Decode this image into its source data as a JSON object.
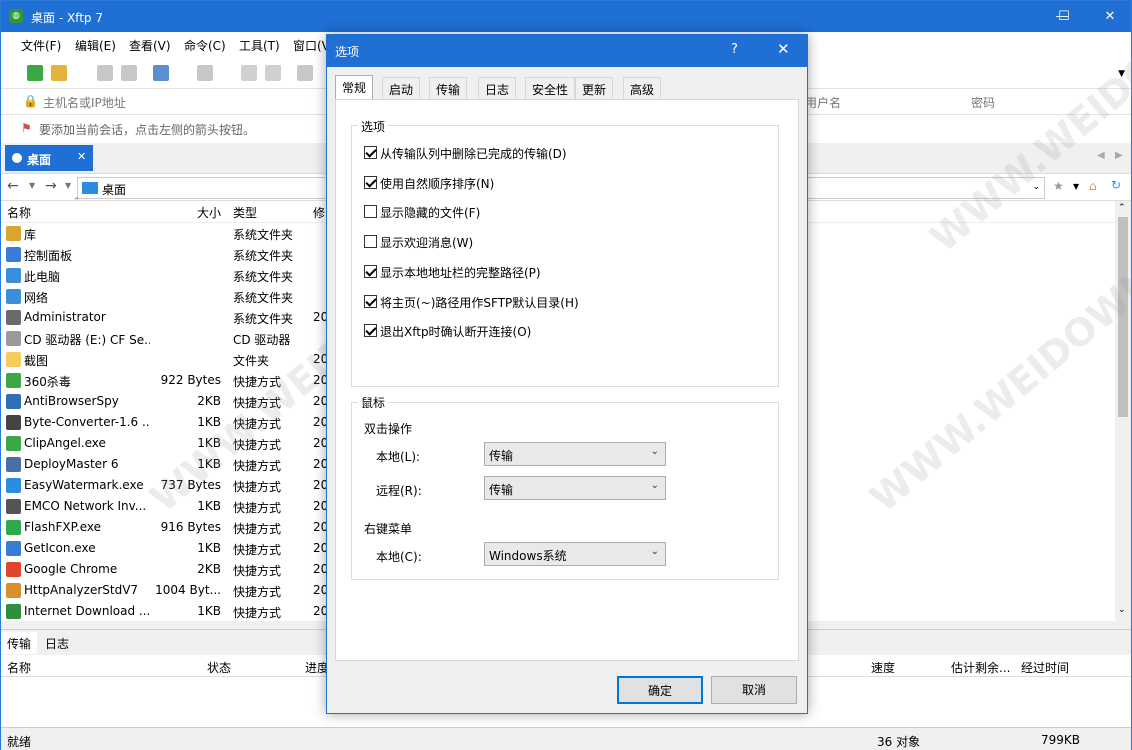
{
  "window": {
    "title": "桌面 - Xftp 7",
    "icon": "xftp-app-icon"
  },
  "menu": [
    "文件(F)",
    "编辑(E)",
    "查看(V)",
    "命令(C)",
    "工具(T)",
    "窗口(V"
  ],
  "address": {
    "host_placeholder": "主机名或IP地址",
    "user_placeholder": "用户名",
    "password_placeholder": "密码"
  },
  "hint": "要添加当前会话，点击左侧的箭头按钮。",
  "doc_tab": {
    "label": "桌面"
  },
  "path": {
    "value": "桌面"
  },
  "file_columns": {
    "name": "名称",
    "size": "大小",
    "type": "类型",
    "modified": "修"
  },
  "files": [
    {
      "name": "库",
      "size": "",
      "type": "系统文件夹",
      "mod": "",
      "icon": "library-icon",
      "color": "#d9a52c"
    },
    {
      "name": "控制面板",
      "size": "",
      "type": "系统文件夹",
      "mod": "",
      "icon": "control-panel-icon",
      "color": "#3a7bd5"
    },
    {
      "name": "此电脑",
      "size": "",
      "type": "系统文件夹",
      "mod": "",
      "icon": "computer-icon",
      "color": "#3a8fd9"
    },
    {
      "name": "网络",
      "size": "",
      "type": "系统文件夹",
      "mod": "",
      "icon": "network-icon",
      "color": "#3a8fd9"
    },
    {
      "name": "Administrator",
      "size": "",
      "type": "系统文件夹",
      "mod": "20",
      "icon": "user-icon",
      "color": "#6b6b6b"
    },
    {
      "name": "CD 驱动器 (E:) CF Se...",
      "size": "",
      "type": "CD 驱动器",
      "mod": "",
      "icon": "cd-drive-icon",
      "color": "#9a9a9a"
    },
    {
      "name": "截图",
      "size": "",
      "type": "文件夹",
      "mod": "20",
      "icon": "folder-icon",
      "color": "#f3cc5c"
    },
    {
      "name": "360杀毒",
      "size": "922 Bytes",
      "type": "快捷方式",
      "mod": "20",
      "icon": "shortcut-icon",
      "color": "#3aa845"
    },
    {
      "name": "AntiBrowserSpy",
      "size": "2KB",
      "type": "快捷方式",
      "mod": "20",
      "icon": "shortcut-icon",
      "color": "#2f6fb3"
    },
    {
      "name": "Byte-Converter-1.6 ...",
      "size": "1KB",
      "type": "快捷方式",
      "mod": "20",
      "icon": "shortcut-icon",
      "color": "#444444"
    },
    {
      "name": "ClipAngel.exe",
      "size": "1KB",
      "type": "快捷方式",
      "mod": "20",
      "icon": "shortcut-icon",
      "color": "#3aa845"
    },
    {
      "name": "DeployMaster 6",
      "size": "1KB",
      "type": "快捷方式",
      "mod": "20",
      "icon": "shortcut-icon",
      "color": "#4a6fa5"
    },
    {
      "name": "EasyWatermark.exe",
      "size": "737 Bytes",
      "type": "快捷方式",
      "mod": "20",
      "icon": "shortcut-icon",
      "color": "#2b8de0"
    },
    {
      "name": "EMCO Network Inv...",
      "size": "1KB",
      "type": "快捷方式",
      "mod": "20",
      "icon": "shortcut-icon",
      "color": "#555555"
    },
    {
      "name": "FlashFXP.exe",
      "size": "916 Bytes",
      "type": "快捷方式",
      "mod": "20",
      "icon": "shortcut-icon",
      "color": "#2fa84f"
    },
    {
      "name": "GetIcon.exe",
      "size": "1KB",
      "type": "快捷方式",
      "mod": "20",
      "icon": "shortcut-icon",
      "color": "#3a7bd5"
    },
    {
      "name": "Google Chrome",
      "size": "2KB",
      "type": "快捷方式",
      "mod": "20",
      "icon": "chrome-icon",
      "color": "#e0452f"
    },
    {
      "name": "HttpAnalyzerStdV7",
      "size": "1004 Byt...",
      "type": "快捷方式",
      "mod": "20",
      "icon": "shortcut-icon",
      "color": "#d9902c"
    },
    {
      "name": "Internet Download ...",
      "size": "1KB",
      "type": "快捷方式",
      "mod": "20",
      "icon": "shortcut-icon",
      "color": "#2f8f3a"
    }
  ],
  "bottom_tabs": [
    "传输",
    "日志"
  ],
  "transfer_columns": {
    "name": "名称",
    "status": "状态",
    "progress": "进度",
    "speed": "速度",
    "remaining": "估计剩余...",
    "elapsed": "经过时间"
  },
  "status": {
    "left": "就绪",
    "count": "36 对象",
    "size": "799KB"
  },
  "watermark": "WWW.WEIDOWN.COM",
  "dialog": {
    "title": "选项",
    "help": "?",
    "close": "✕",
    "tabs": [
      "常规",
      "启动",
      "传输",
      "日志",
      "安全性",
      "更新",
      "高级"
    ],
    "options_group": "选项",
    "options": [
      {
        "label": "从传输队列中删除已完成的传输(D)",
        "checked": true
      },
      {
        "label": "使用自然顺序排序(N)",
        "checked": true
      },
      {
        "label": "显示隐藏的文件(F)",
        "checked": false
      },
      {
        "label": "显示欢迎消息(W)",
        "checked": false
      },
      {
        "label": "显示本地地址栏的完整路径(P)",
        "checked": true
      },
      {
        "label": "将主页(~)路径用作SFTP默认目录(H)",
        "checked": true
      },
      {
        "label": "退出Xftp时确认断开连接(O)",
        "checked": true
      }
    ],
    "mouse_group": "鼠标",
    "double_click_label": "双击操作",
    "local_label": "本地(L):",
    "local_value": "传输",
    "remote_label": "远程(R):",
    "remote_value": "传输",
    "context_menu_label": "右键菜单",
    "context_local_label": "本地(C):",
    "context_local_value": "Windows系统",
    "ok": "确定",
    "cancel": "取消"
  }
}
